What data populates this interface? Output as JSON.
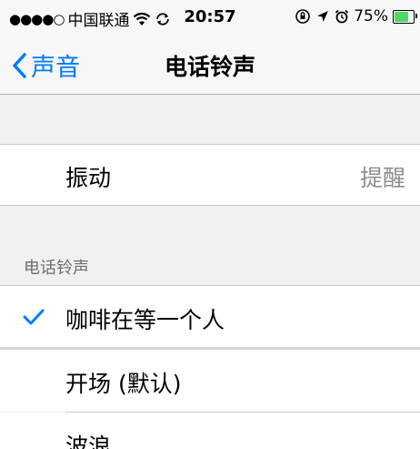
{
  "status_bar": {
    "signal_dots": "●●●●○",
    "carrier": "中国联通",
    "wifi_icon": "wifi-icon",
    "sync_icon": "sync-icon",
    "time": "20:57",
    "orientation_lock_icon": "orientation-lock-icon",
    "location_icon": "location-arrow-icon",
    "alarm_icon": "alarm-icon",
    "battery": "75%",
    "battery_level": 0.75,
    "battery_color": "#4cd964"
  },
  "nav": {
    "back_label": "声音",
    "title": "电话铃声"
  },
  "vibration": {
    "label": "振动",
    "value": "提醒"
  },
  "ringtones": {
    "header": "电话铃声",
    "items": [
      {
        "label": "咖啡在等一个人",
        "selected": true
      },
      {
        "label": "开场 (默认)",
        "selected": false
      },
      {
        "label": "波浪",
        "selected": false
      }
    ]
  },
  "colors": {
    "accent": "#007aff",
    "background": "#efeff4",
    "separator": "#c8c7cc",
    "secondary_text": "#8e8e93"
  }
}
